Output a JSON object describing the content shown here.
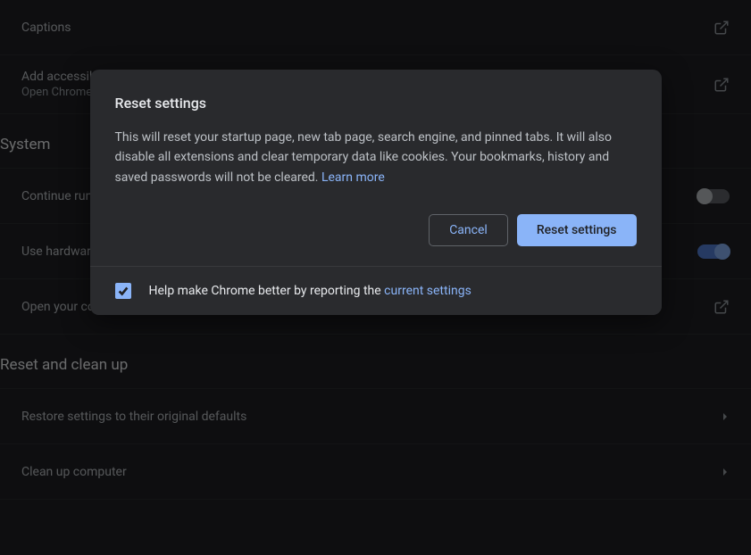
{
  "accessibility": {
    "captions": {
      "title": "Captions"
    },
    "add_features": {
      "title": "Add accessibility features",
      "subtitle": "Open Chrome Web Store"
    }
  },
  "sections": {
    "system": "System",
    "reset": "Reset and clean up"
  },
  "system": {
    "continue_running": {
      "title": "Continue running background apps when Google Chrome is closed"
    },
    "hardware_accel": {
      "title": "Use hardware acceleration when available"
    },
    "proxy": {
      "title": "Open your computer's proxy settings"
    }
  },
  "reset": {
    "restore": {
      "title": "Restore settings to their original defaults"
    },
    "cleanup": {
      "title": "Clean up computer"
    }
  },
  "dialog": {
    "title": "Reset settings",
    "body": "This will reset your startup page, new tab page, search engine, and pinned tabs. It will also disable all extensions and clear temporary data like cookies. Your bookmarks, history and saved passwords will not be cleared. ",
    "learn_more": "Learn more",
    "cancel": "Cancel",
    "confirm": "Reset settings",
    "footer_text": "Help make Chrome better by reporting the ",
    "footer_link": "current settings"
  }
}
